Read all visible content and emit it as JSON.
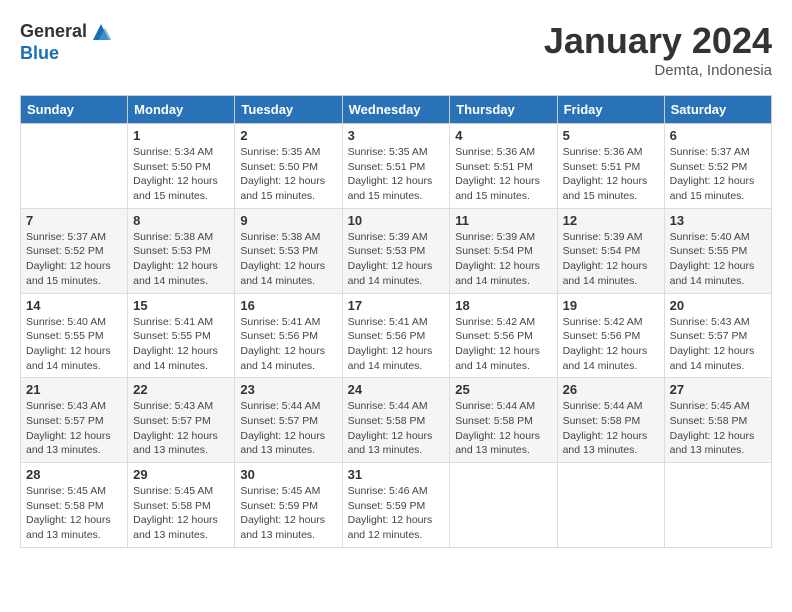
{
  "logo": {
    "general": "General",
    "blue": "Blue"
  },
  "title": {
    "month": "January 2024",
    "location": "Demta, Indonesia"
  },
  "weekdays": [
    "Sunday",
    "Monday",
    "Tuesday",
    "Wednesday",
    "Thursday",
    "Friday",
    "Saturday"
  ],
  "weeks": [
    [
      {
        "day": "",
        "info": ""
      },
      {
        "day": "1",
        "info": "Sunrise: 5:34 AM\nSunset: 5:50 PM\nDaylight: 12 hours\nand 15 minutes."
      },
      {
        "day": "2",
        "info": "Sunrise: 5:35 AM\nSunset: 5:50 PM\nDaylight: 12 hours\nand 15 minutes."
      },
      {
        "day": "3",
        "info": "Sunrise: 5:35 AM\nSunset: 5:51 PM\nDaylight: 12 hours\nand 15 minutes."
      },
      {
        "day": "4",
        "info": "Sunrise: 5:36 AM\nSunset: 5:51 PM\nDaylight: 12 hours\nand 15 minutes."
      },
      {
        "day": "5",
        "info": "Sunrise: 5:36 AM\nSunset: 5:51 PM\nDaylight: 12 hours\nand 15 minutes."
      },
      {
        "day": "6",
        "info": "Sunrise: 5:37 AM\nSunset: 5:52 PM\nDaylight: 12 hours\nand 15 minutes."
      }
    ],
    [
      {
        "day": "7",
        "info": "Sunrise: 5:37 AM\nSunset: 5:52 PM\nDaylight: 12 hours\nand 15 minutes."
      },
      {
        "day": "8",
        "info": "Sunrise: 5:38 AM\nSunset: 5:53 PM\nDaylight: 12 hours\nand 14 minutes."
      },
      {
        "day": "9",
        "info": "Sunrise: 5:38 AM\nSunset: 5:53 PM\nDaylight: 12 hours\nand 14 minutes."
      },
      {
        "day": "10",
        "info": "Sunrise: 5:39 AM\nSunset: 5:53 PM\nDaylight: 12 hours\nand 14 minutes."
      },
      {
        "day": "11",
        "info": "Sunrise: 5:39 AM\nSunset: 5:54 PM\nDaylight: 12 hours\nand 14 minutes."
      },
      {
        "day": "12",
        "info": "Sunrise: 5:39 AM\nSunset: 5:54 PM\nDaylight: 12 hours\nand 14 minutes."
      },
      {
        "day": "13",
        "info": "Sunrise: 5:40 AM\nSunset: 5:55 PM\nDaylight: 12 hours\nand 14 minutes."
      }
    ],
    [
      {
        "day": "14",
        "info": "Sunrise: 5:40 AM\nSunset: 5:55 PM\nDaylight: 12 hours\nand 14 minutes."
      },
      {
        "day": "15",
        "info": "Sunrise: 5:41 AM\nSunset: 5:55 PM\nDaylight: 12 hours\nand 14 minutes."
      },
      {
        "day": "16",
        "info": "Sunrise: 5:41 AM\nSunset: 5:56 PM\nDaylight: 12 hours\nand 14 minutes."
      },
      {
        "day": "17",
        "info": "Sunrise: 5:41 AM\nSunset: 5:56 PM\nDaylight: 12 hours\nand 14 minutes."
      },
      {
        "day": "18",
        "info": "Sunrise: 5:42 AM\nSunset: 5:56 PM\nDaylight: 12 hours\nand 14 minutes."
      },
      {
        "day": "19",
        "info": "Sunrise: 5:42 AM\nSunset: 5:56 PM\nDaylight: 12 hours\nand 14 minutes."
      },
      {
        "day": "20",
        "info": "Sunrise: 5:43 AM\nSunset: 5:57 PM\nDaylight: 12 hours\nand 14 minutes."
      }
    ],
    [
      {
        "day": "21",
        "info": "Sunrise: 5:43 AM\nSunset: 5:57 PM\nDaylight: 12 hours\nand 13 minutes."
      },
      {
        "day": "22",
        "info": "Sunrise: 5:43 AM\nSunset: 5:57 PM\nDaylight: 12 hours\nand 13 minutes."
      },
      {
        "day": "23",
        "info": "Sunrise: 5:44 AM\nSunset: 5:57 PM\nDaylight: 12 hours\nand 13 minutes."
      },
      {
        "day": "24",
        "info": "Sunrise: 5:44 AM\nSunset: 5:58 PM\nDaylight: 12 hours\nand 13 minutes."
      },
      {
        "day": "25",
        "info": "Sunrise: 5:44 AM\nSunset: 5:58 PM\nDaylight: 12 hours\nand 13 minutes."
      },
      {
        "day": "26",
        "info": "Sunrise: 5:44 AM\nSunset: 5:58 PM\nDaylight: 12 hours\nand 13 minutes."
      },
      {
        "day": "27",
        "info": "Sunrise: 5:45 AM\nSunset: 5:58 PM\nDaylight: 12 hours\nand 13 minutes."
      }
    ],
    [
      {
        "day": "28",
        "info": "Sunrise: 5:45 AM\nSunset: 5:58 PM\nDaylight: 12 hours\nand 13 minutes."
      },
      {
        "day": "29",
        "info": "Sunrise: 5:45 AM\nSunset: 5:58 PM\nDaylight: 12 hours\nand 13 minutes."
      },
      {
        "day": "30",
        "info": "Sunrise: 5:45 AM\nSunset: 5:59 PM\nDaylight: 12 hours\nand 13 minutes."
      },
      {
        "day": "31",
        "info": "Sunrise: 5:46 AM\nSunset: 5:59 PM\nDaylight: 12 hours\nand 12 minutes."
      },
      {
        "day": "",
        "info": ""
      },
      {
        "day": "",
        "info": ""
      },
      {
        "day": "",
        "info": ""
      }
    ]
  ]
}
